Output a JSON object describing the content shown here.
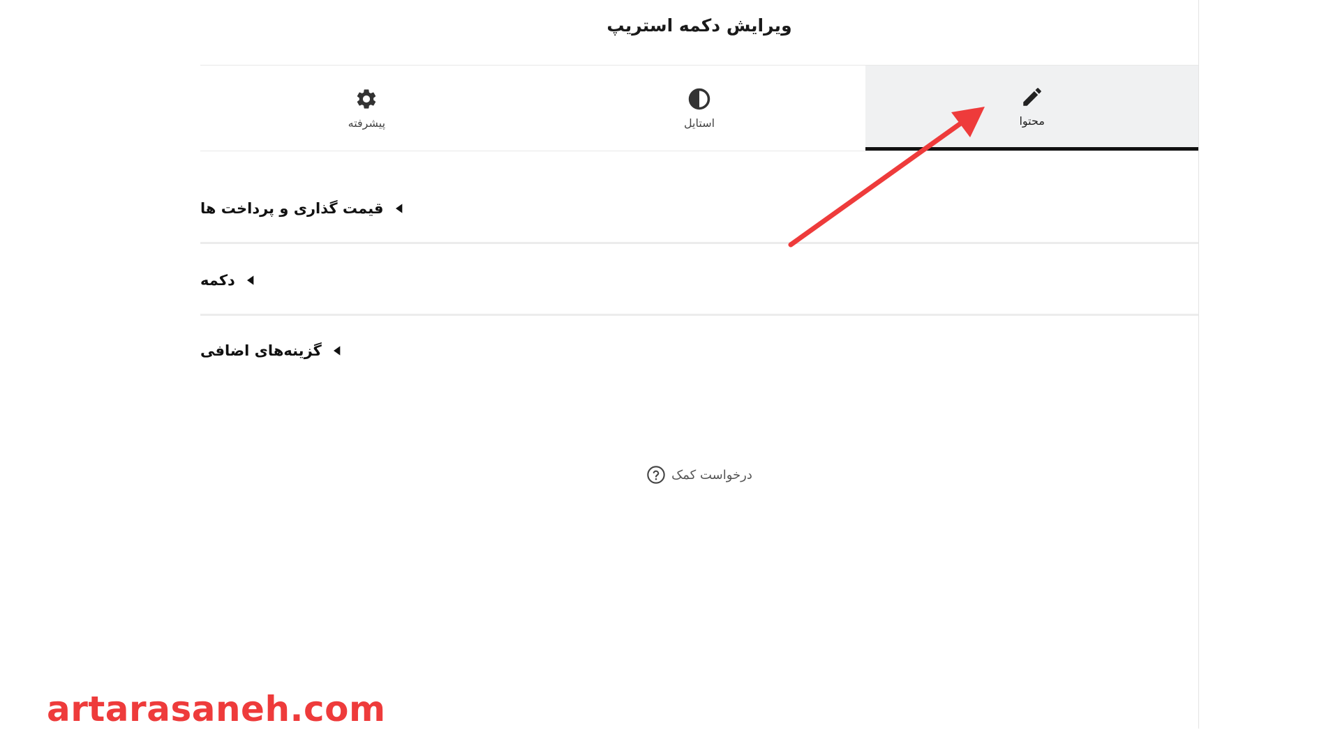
{
  "panel": {
    "title": "ویرایش دکمه استریپ"
  },
  "tabs": [
    {
      "label": "محتوا",
      "icon": "pencil-icon",
      "active": true
    },
    {
      "label": "استایل",
      "icon": "contrast-icon",
      "active": false
    },
    {
      "label": "پیشرفته",
      "icon": "gear-icon",
      "active": false
    }
  ],
  "sections": [
    {
      "label": "قیمت گذاری و پرداخت ها"
    },
    {
      "label": "دکمه"
    },
    {
      "label": "گزینه‌های اضافی"
    }
  ],
  "help": {
    "label": "درخواست کمک",
    "icon": "question-circle-icon"
  },
  "annotation": {
    "arrow_color": "#ee3b3b"
  },
  "watermark": {
    "text": "artarasaneh.com",
    "color": "#ee3b3b"
  },
  "colors": {
    "active_tab_bg": "#f0f1f2",
    "active_tab_underline": "#111111"
  }
}
